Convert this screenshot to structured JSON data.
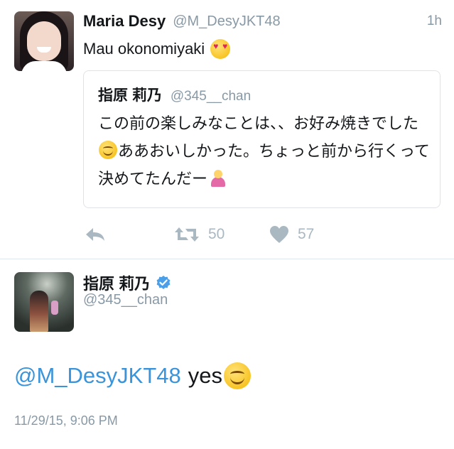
{
  "tweet": {
    "display_name": "Maria Desy",
    "handle": "@M_DesyJKT48",
    "time": "1h",
    "text": "Mau okonomiyaki",
    "emoji": "heart-eyes-emoji",
    "quote": {
      "display_name": "指原 莉乃",
      "handle": "@345__chan",
      "text_part1": "この前の楽しみなことは、、お好み焼きでした",
      "text_part2": "ああおいしかった。ちょっと前から行くって決めてたんだー",
      "emoji_1": "smiling-face-emoji",
      "emoji_2": "person-raising-hands-emoji"
    },
    "actions": {
      "reply_icon": "reply-icon",
      "retweet_icon": "retweet-icon",
      "retweet_count": "50",
      "like_icon": "heart-icon",
      "like_count": "57"
    }
  },
  "reply": {
    "display_name": "指原 莉乃",
    "handle": "@345__chan",
    "verified_icon": "verified-badge-icon",
    "mention": "@M_DesyJKT48",
    "text": "yes",
    "emoji": "smiling-face-emoji",
    "timestamp": "11/29/15, 9:06 PM"
  },
  "colors": {
    "link": "#3b94d9",
    "secondary_text": "#8899a6",
    "action_gray": "#aab8c2",
    "verified_blue": "#4a9fe8"
  }
}
